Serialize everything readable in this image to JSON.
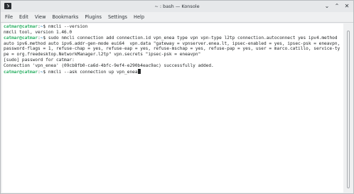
{
  "window": {
    "title": "~ : bash — Konsole",
    "app_icon": "konsole-terminal-icon",
    "controls": {
      "minimize": "⌄",
      "maximize": "⌃",
      "close": "✕"
    }
  },
  "menu": {
    "items": [
      "File",
      "Edit",
      "View",
      "Bookmarks",
      "Plugins",
      "Settings",
      "Help"
    ]
  },
  "terminal": {
    "prompt_user": "catmar@catmar",
    "prompt_cwd": "~",
    "prompt_symbol": "$",
    "cmd1": "nmcli --version",
    "out1": "nmcli tool, version 1.46.0",
    "cmd2": "sudo nmcli connection add connection.id vpn_enea type vpn vpn-type l2tp connection.autoconnect yes ipv4.method auto ipv6.method auto ipv6.addr-gen-mode eui64  vpn.data \"gateway = vpnserver.enea.lt, ipsec-enabled = yes, ipsec-psk = eneavpn, password-flags = 1, refuse-chap = yes, refuse-eap = yes, refuse-mschap = yes, refuse-pap = yes, user = marco.catillo, service-type = org.freedesktop.NetworkManager.l2tp\" vpn.secrets \"ipsec-psk = eneavpn\"",
    "out2a": "[sudo] password for catmar:",
    "out2b": "Connection 'vpn_enea' (09cb8fb0-ca6d-4bfc-9ef4-e290b4eac9ac) successfully added.",
    "cmd3": "nmcli --ask connection up vpn_enea"
  }
}
